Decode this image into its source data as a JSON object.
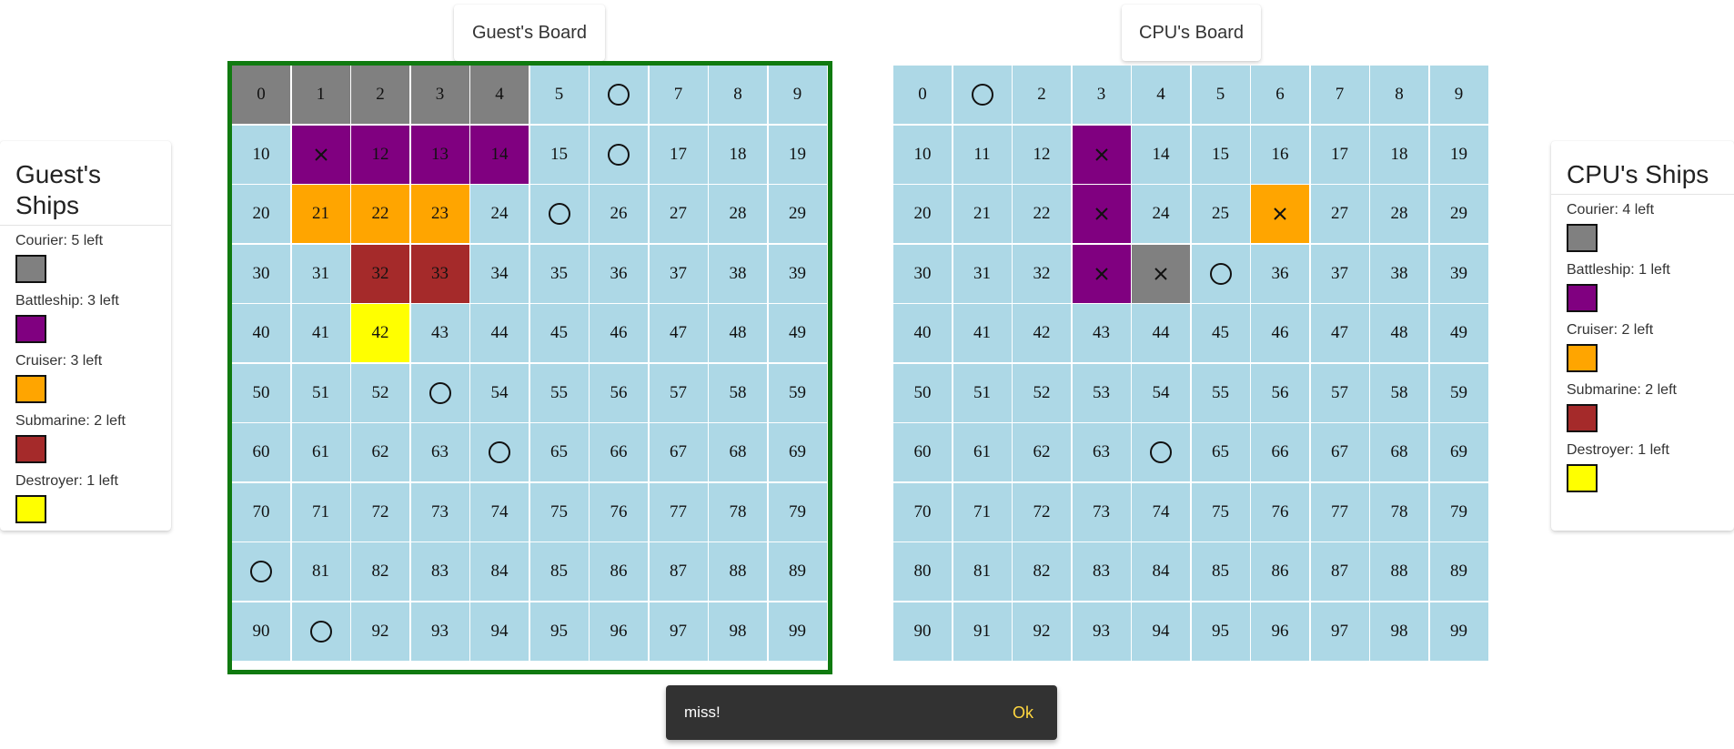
{
  "boards": {
    "guest": {
      "title": "Guest's Board",
      "active_border_color": "#107a10",
      "cells": [
        "courier",
        "courier",
        "courier",
        "courier",
        "courier",
        "water",
        "water",
        "water",
        "water",
        "water",
        "water",
        "battleship",
        "battleship",
        "battleship",
        "battleship",
        "water",
        "water",
        "water",
        "water",
        "water",
        "water",
        "cruiser",
        "cruiser",
        "cruiser",
        "water",
        "water",
        "water",
        "water",
        "water",
        "water",
        "water",
        "water",
        "submarine",
        "submarine",
        "water",
        "water",
        "water",
        "water",
        "water",
        "water",
        "water",
        "water",
        "destroyer",
        "water",
        "water",
        "water",
        "water",
        "water",
        "water",
        "water",
        "water",
        "water",
        "water",
        "water",
        "water",
        "water",
        "water",
        "water",
        "water",
        "water",
        "water",
        "water",
        "water",
        "water",
        "water",
        "water",
        "water",
        "water",
        "water",
        "water",
        "water",
        "water",
        "water",
        "water",
        "water",
        "water",
        "water",
        "water",
        "water",
        "water",
        "water",
        "water",
        "water",
        "water",
        "water",
        "water",
        "water",
        "water",
        "water",
        "water",
        "water",
        "water",
        "water",
        "water",
        "water",
        "water",
        "water",
        "water",
        "water",
        "water"
      ],
      "hits": [
        11
      ],
      "misses": [
        6,
        16,
        25,
        53,
        64,
        80,
        91
      ]
    },
    "cpu": {
      "title": "CPU's Board",
      "cells": [
        "water",
        "water",
        "water",
        "water",
        "water",
        "water",
        "water",
        "water",
        "water",
        "water",
        "water",
        "water",
        "water",
        "battleship",
        "water",
        "water",
        "water",
        "water",
        "water",
        "water",
        "water",
        "water",
        "water",
        "battleship",
        "water",
        "water",
        "cruiser",
        "water",
        "water",
        "water",
        "water",
        "water",
        "water",
        "battleship",
        "courier",
        "water",
        "water",
        "water",
        "water",
        "water",
        "water",
        "water",
        "water",
        "water",
        "water",
        "water",
        "water",
        "water",
        "water",
        "water",
        "water",
        "water",
        "water",
        "water",
        "water",
        "water",
        "water",
        "water",
        "water",
        "water",
        "water",
        "water",
        "water",
        "water",
        "water",
        "water",
        "water",
        "water",
        "water",
        "water",
        "water",
        "water",
        "water",
        "water",
        "water",
        "water",
        "water",
        "water",
        "water",
        "water",
        "water",
        "water",
        "water",
        "water",
        "water",
        "water",
        "water",
        "water",
        "water",
        "water",
        "water",
        "water",
        "water",
        "water",
        "water",
        "water",
        "water",
        "water",
        "water",
        "water"
      ],
      "hits": [
        13,
        23,
        26,
        33,
        34
      ],
      "misses": [
        1,
        35,
        64
      ]
    }
  },
  "ship_colors": {
    "water": "#add8e6",
    "courier": "#808080",
    "battleship": "#800080",
    "cruiser": "#ffa500",
    "submarine": "#a52a2a",
    "destroyer": "#ffff00"
  },
  "guest_ships": {
    "title": "Guest's Ships",
    "items": [
      {
        "label": "Courier: 5 left",
        "color": "#808080"
      },
      {
        "label": "Battleship: 3 left",
        "color": "#800080"
      },
      {
        "label": "Cruiser: 3 left",
        "color": "#ffa500"
      },
      {
        "label": "Submarine: 2 left",
        "color": "#a52a2a"
      },
      {
        "label": "Destroyer: 1 left",
        "color": "#ffff00"
      }
    ]
  },
  "cpu_ships": {
    "title": "CPU's Ships",
    "items": [
      {
        "label": "Courier: 4 left",
        "color": "#808080"
      },
      {
        "label": "Battleship: 1 left",
        "color": "#800080"
      },
      {
        "label": "Cruiser: 2 left",
        "color": "#ffa500"
      },
      {
        "label": "Submarine: 2 left",
        "color": "#a52a2a"
      },
      {
        "label": "Destroyer: 1 left",
        "color": "#ffff00"
      }
    ]
  },
  "snackbar": {
    "message": "miss!",
    "action": "Ok"
  }
}
